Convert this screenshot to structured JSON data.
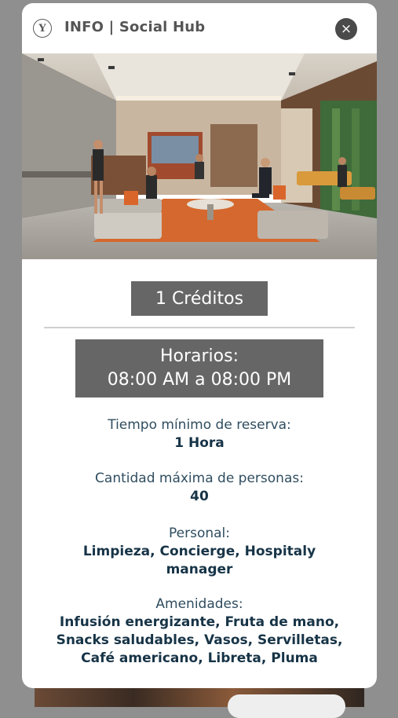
{
  "header": {
    "title": "INFO | Social Hub",
    "logo_glyph": "Y",
    "close_icon": "×"
  },
  "space": {
    "credits": "1 Créditos",
    "hours_title": "Horarios:",
    "hours_value": "08:00 AM a 08:00 PM"
  },
  "details": {
    "min_time_label": "Tiempo mínimo de reserva:",
    "min_time_value": "1 Hora",
    "max_people_label": "Cantidad máxima de personas:",
    "max_people_value": "40",
    "staff_label": "Personal:",
    "staff_value_line1": "Limpieza, Concierge, Hospitaly",
    "staff_value_line2": "manager",
    "amenities_label": "Amenidades:",
    "amenities_value_line1": "Infusión energizante, Fruta de mano,",
    "amenities_value_line2": "Snacks saludables, Vasos, Servilletas,",
    "amenities_value_line3": "Café americano, Libreta, Pluma"
  }
}
